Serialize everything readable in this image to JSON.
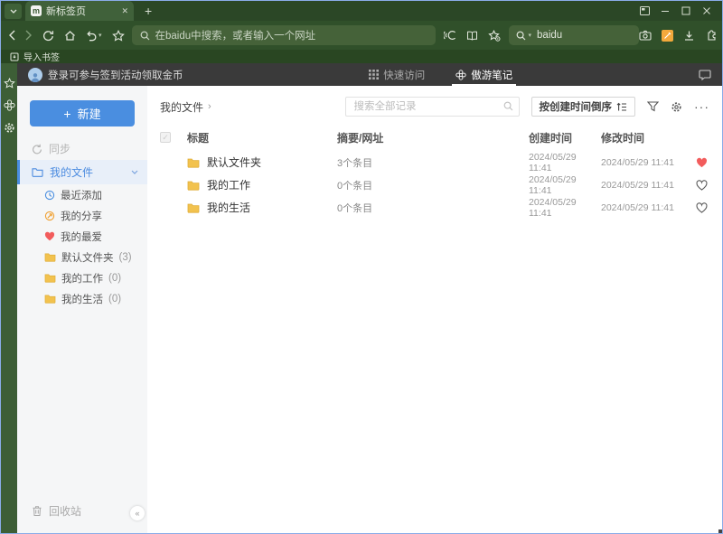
{
  "browser": {
    "tab_title": "新标签页",
    "address_placeholder": "在baidu中搜索，或者输入一个网址",
    "search_engine": "baidu",
    "import_bookmarks_label": "导入书签"
  },
  "app": {
    "header": {
      "login_text": "登录可参与签到活动领取金币",
      "tabs": [
        {
          "label": "快速访问"
        },
        {
          "label": "傲游笔记"
        }
      ]
    },
    "sidebar": {
      "new_button": "新建",
      "sync_label": "同步",
      "my_files_label": "我的文件",
      "items": [
        {
          "label": "最近添加",
          "count": ""
        },
        {
          "label": "我的分享",
          "count": ""
        },
        {
          "label": "我的最爱",
          "count": ""
        },
        {
          "label": "默认文件夹",
          "count": "(3)"
        },
        {
          "label": "我的工作",
          "count": "(0)"
        },
        {
          "label": "我的生活",
          "count": "(0)"
        }
      ],
      "recycle_bin_label": "回收站"
    },
    "content": {
      "breadcrumb": "我的文件",
      "search_placeholder": "搜索全部记录",
      "sort_label": "按创建时间倒序",
      "table": {
        "headers": {
          "title": "标题",
          "summary": "摘要/网址",
          "created": "创建时间",
          "modified": "修改时间"
        },
        "rows": [
          {
            "title": "默认文件夹",
            "summary": "3个条目",
            "created": "2024/05/29 11:41",
            "modified": "2024/05/29 11:41",
            "favorite": true
          },
          {
            "title": "我的工作",
            "summary": "0个条目",
            "created": "2024/05/29 11:41",
            "modified": "2024/05/29 11:41",
            "favorite": false
          },
          {
            "title": "我的生活",
            "summary": "0个条目",
            "created": "2024/05/29 11:41",
            "modified": "2024/05/29 11:41",
            "favorite": false
          }
        ]
      }
    }
  },
  "icons": {
    "close": "✕",
    "plus": "+",
    "collapse": "«",
    "ellipsis": "···",
    "caret_down": "▾",
    "breadcrumb_arrow": "›",
    "check": "✓"
  },
  "colors": {
    "chrome_green": "#2b4726",
    "accent_blue": "#4a8ee0",
    "selected_bg": "#e8eff9",
    "folder_yellow": "#f2c24e",
    "favorite_red": "#f25c5c",
    "app_header_gray": "#3a3a3a"
  }
}
